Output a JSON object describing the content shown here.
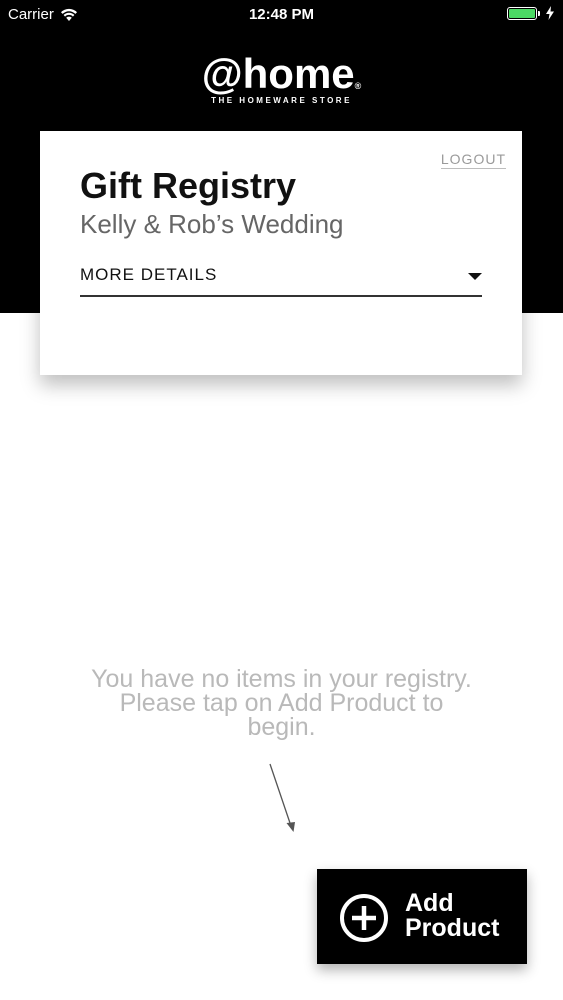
{
  "status_bar": {
    "carrier": "Carrier",
    "time": "12:48 PM",
    "battery_level": 1.0,
    "battery_color": "#4cd964"
  },
  "header": {
    "logo_text": "@home",
    "logo_reg_mark": "®",
    "tagline": "THE HOMEWARE STORE",
    "background_color": "#000000"
  },
  "card": {
    "logout_label": "LOGOUT",
    "title": "Gift Registry",
    "subtitle": "Kelly & Rob’s Wedding",
    "details_label": "MORE DETAILS"
  },
  "empty_state": {
    "message": "You have no items in your registry. Please tap on Add Product to begin."
  },
  "add_button": {
    "label_line1": "Add",
    "label_line2": "Product"
  },
  "icons": {
    "wifi": "wifi-icon",
    "battery": "battery-icon",
    "charging": "charging-bolt-icon",
    "caret": "caret-down-icon",
    "arrow": "hint-arrow-icon",
    "add": "plus-circle-icon"
  }
}
